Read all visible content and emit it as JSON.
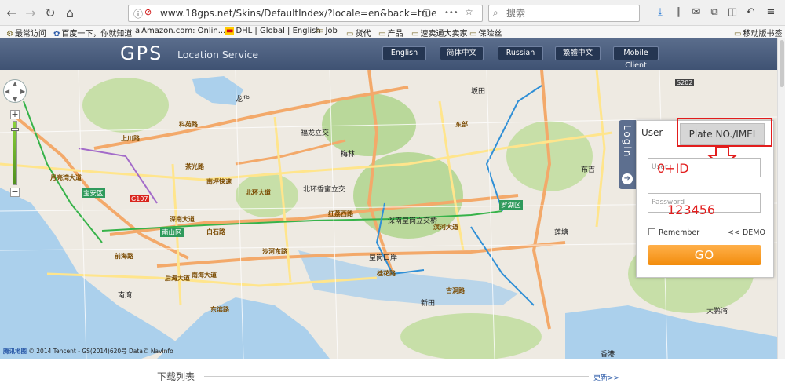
{
  "browser": {
    "url": "www.18gps.net/Skins/DefaultIndex/?locale=en&back=true",
    "search_placeholder": "搜索",
    "url_more": "•••"
  },
  "bookmarks": [
    {
      "label": "最常访问",
      "icon": "gear-icon"
    },
    {
      "label": "百度一下，你就知道",
      "icon": "paw-icon"
    },
    {
      "label": "Amazon.com: Onlin...",
      "icon": "amazon-icon"
    },
    {
      "label": "DHL | Global | English",
      "icon": "dhl-icon"
    },
    {
      "label": "Job",
      "icon": "folder-icon"
    },
    {
      "label": "货代",
      "icon": "folder-icon"
    },
    {
      "label": "产品",
      "icon": "folder-icon"
    },
    {
      "label": "速卖通大卖家",
      "icon": "folder-icon"
    },
    {
      "label": "保险丝",
      "icon": "folder-icon"
    },
    {
      "label": "移动版书签",
      "icon": "folder-icon"
    }
  ],
  "site": {
    "logo": "GPS",
    "subtitle": "Location Service",
    "languages": [
      "English",
      "简体中文",
      "Russian",
      "繁體中文",
      "Mobile Client"
    ]
  },
  "map": {
    "labels": {
      "l1": "宝安区",
      "l2": "南山区",
      "l3": "罗湖区",
      "l4": "北环大道",
      "l5": "北环香蜜立交",
      "l6": "深南大道",
      "l7": "深南皇岗立交桥",
      "l8": "南海大道",
      "l9": "沙河东路",
      "l10": "红荔西路",
      "l11": "滨河大道",
      "l12": "福龙立交",
      "l13": "南坪快速",
      "l14": "茶光路",
      "l15": "白石路",
      "l16": "后海大道",
      "l17": "桂花路",
      "l18": "东滨路",
      "l19": "布吉",
      "l20": "东部",
      "l21": "上川路",
      "l22": "香港",
      "l23": "龙华",
      "l24": "G107",
      "l25": "S202",
      "l26": "新田",
      "l27": "古洞路",
      "l28": "皇岗口岸",
      "l29": "莲塘",
      "l30": "大鹏湾",
      "l31": "梅林",
      "l32": "科苑路",
      "l33": "前海路",
      "l34": "月亮湾大道",
      "l35": "南湾",
      "l36": "坂田"
    },
    "copyright": "© 2014 Tencent - GS(2014)620号 Data© NavInfo",
    "brand": "腾讯地图"
  },
  "login": {
    "vertical_tab": "Login",
    "tabs": [
      "User",
      "Plate NO./IMEI"
    ],
    "user_placeholder": "User",
    "password_placeholder": "Password",
    "note_id": "0+ID",
    "note_password": "123456",
    "remember": "Remember",
    "demo": "<< DEMO",
    "go": "GO"
  },
  "downloads": {
    "title": "下载列表",
    "more": "更新>>"
  }
}
